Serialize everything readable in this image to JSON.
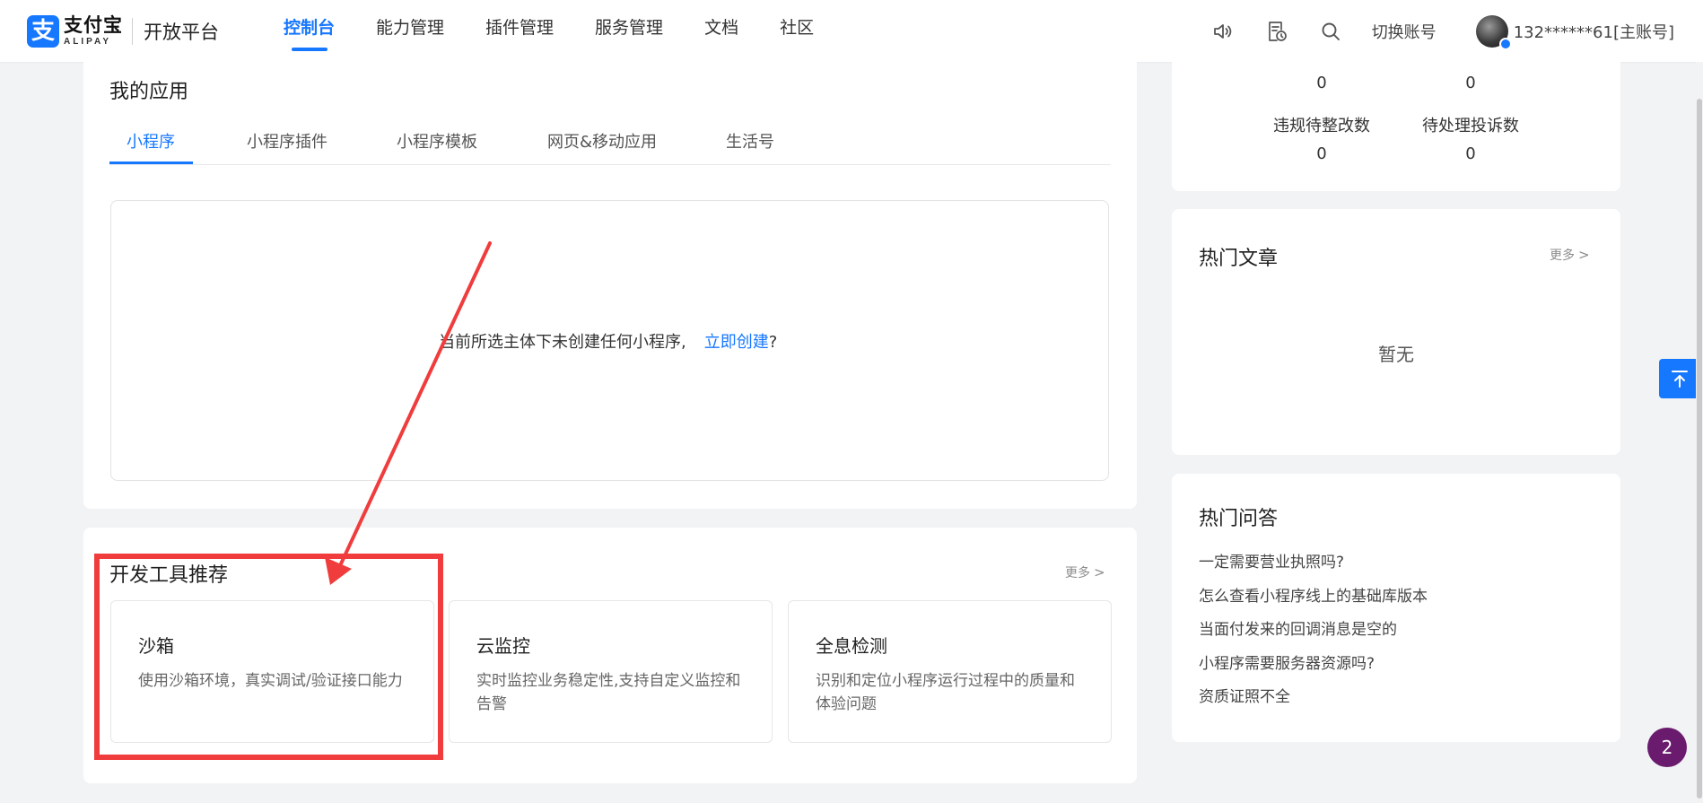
{
  "brand": {
    "logo_glyph": "支",
    "logo_cn": "支付宝",
    "logo_en": "ALIPAY",
    "platform": "开放平台",
    "accent": "#1677ff"
  },
  "nav": {
    "tabs": [
      {
        "label": "控制台",
        "active": true
      },
      {
        "label": "能力管理"
      },
      {
        "label": "插件管理"
      },
      {
        "label": "服务管理"
      },
      {
        "label": "文档"
      },
      {
        "label": "社区"
      }
    ],
    "switch_account": "切换账号",
    "account": "132******61[主账号]",
    "icons": [
      "speaker-icon",
      "document-clock-icon",
      "search-icon"
    ]
  },
  "my_apps": {
    "title": "我的应用",
    "tabs": [
      "小程序",
      "小程序插件",
      "小程序模板",
      "网页&移动应用",
      "生活号"
    ],
    "empty_text": "当前所选主体下未创建任何小程序,",
    "create_link": "立即创建",
    "create_suffix": "?"
  },
  "tools": {
    "title": "开发工具推荐",
    "more": "更多",
    "items": [
      {
        "name": "沙箱",
        "desc": "使用沙箱环境，真实调试/验证接口能力"
      },
      {
        "name": "云监控",
        "desc": "实时监控业务稳定性,支持自定义监控和告警"
      },
      {
        "name": "全息检测",
        "desc": "识别和定位小程序运行过程中的质量和体验问题"
      }
    ]
  },
  "stats": {
    "top_values": [
      "0",
      "0"
    ],
    "labels": [
      "违规待整改数",
      "待处理投诉数"
    ],
    "values": [
      "0",
      "0"
    ]
  },
  "hot_articles": {
    "title": "热门文章",
    "more": "更多",
    "empty": "暂无"
  },
  "hot_qa": {
    "title": "热门问答",
    "items": [
      "一定需要营业执照吗?",
      "怎么查看小程序线上的基础库版本",
      "当面付发来的回调消息是空的",
      "小程序需要服务器资源吗?",
      "资质证照不全"
    ]
  },
  "floating": {
    "badge_count": "2"
  },
  "annotation_colors": {
    "highlight": "#f03c3c"
  }
}
